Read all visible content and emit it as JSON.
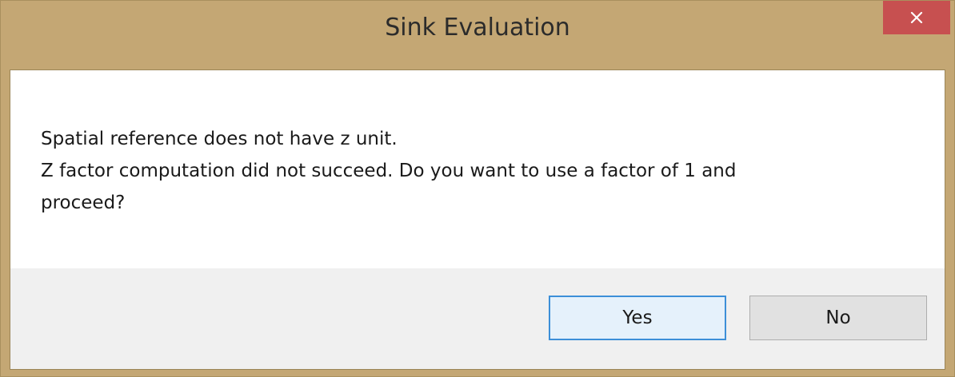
{
  "window": {
    "title": "Sink Evaluation"
  },
  "message": {
    "line1": "Spatial reference does not have z unit.",
    "line2": "Z factor computation did not succeed. Do you want to use a factor of 1 and",
    "line3": "proceed?"
  },
  "buttons": {
    "yes_label": "Yes",
    "no_label": "No"
  },
  "icons": {
    "close": "close-icon"
  },
  "colors": {
    "frame": "#c4a774",
    "close_button": "#c75050",
    "default_button_border": "#3c8fd8",
    "footer": "#f0f0f0"
  }
}
